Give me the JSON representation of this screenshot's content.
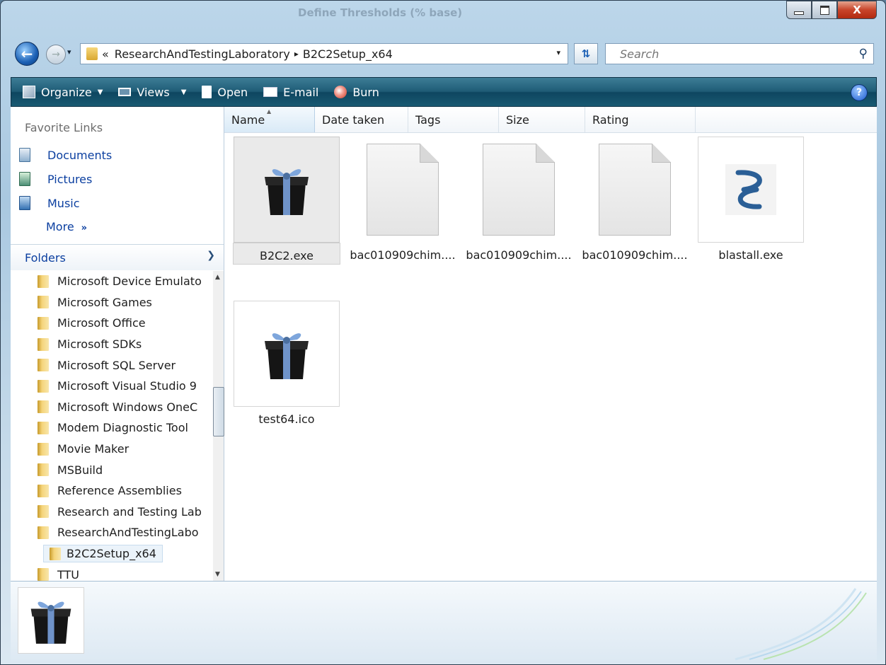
{
  "window": {
    "background_title": "Define Thresholds (% base)",
    "caption": {
      "close_label": "X"
    }
  },
  "navigation": {
    "history_arrow": "▾",
    "breadcrumb": [
      "«",
      "ResearchAndTestingLaboratory",
      "▸",
      "B2C2Setup_x64"
    ],
    "address_dropdown": "▾",
    "search_placeholder": "Search"
  },
  "toolbar": {
    "items": [
      {
        "label": "Organize",
        "icon": "organize-icon",
        "has_dropdown": true
      },
      {
        "label": "Views",
        "icon": "views-icon",
        "has_dropdown": true
      },
      {
        "label": "Open",
        "icon": "open-icon",
        "has_dropdown": false
      },
      {
        "label": "E-mail",
        "icon": "email-icon",
        "has_dropdown": false
      },
      {
        "label": "Burn",
        "icon": "burn-icon",
        "has_dropdown": false
      }
    ],
    "help_label": "?"
  },
  "sidebar": {
    "favorites_header": "Favorite Links",
    "favorites": [
      {
        "label": "Documents",
        "icon": "documents-icon"
      },
      {
        "label": "Pictures",
        "icon": "pictures-icon"
      },
      {
        "label": "Music",
        "icon": "music-icon"
      }
    ],
    "more_label": "More",
    "more_chevron": "»",
    "folders_header": "Folders",
    "folders": [
      "Microsoft Device Emulato",
      "Microsoft Games",
      "Microsoft Office",
      "Microsoft SDKs",
      "Microsoft SQL Server",
      "Microsoft Visual Studio 9",
      "Microsoft Windows OneC",
      "Modem Diagnostic Tool",
      "Movie Maker",
      "MSBuild",
      "Reference Assemblies",
      "Research and Testing Lab",
      "ResearchAndTestingLabo",
      "B2C2Setup_x64",
      "TTU"
    ],
    "selected_folder": "B2C2Setup_x64"
  },
  "columns": [
    "Name",
    "Date taken",
    "Tags",
    "Size",
    "Rating"
  ],
  "sorted_column": "Name",
  "files": [
    {
      "name": "B2C2.exe",
      "icon": "gift-box-icon",
      "selected": true
    },
    {
      "name": "bac010909chim....",
      "icon": "blank-file-icon",
      "selected": false
    },
    {
      "name": "bac010909chim....",
      "icon": "blank-file-icon",
      "selected": false
    },
    {
      "name": "bac010909chim....",
      "icon": "blank-file-icon",
      "selected": false
    },
    {
      "name": "blastall.exe",
      "icon": "helix-icon",
      "selected": false
    },
    {
      "name": "test64.ico",
      "icon": "gift-box-icon",
      "selected": false
    }
  ],
  "preview": {
    "icon": "gift-box-icon"
  },
  "colors": {
    "toolbar": "#1f5c76",
    "link": "#0b3fa0",
    "selection": "#eaeaea"
  }
}
